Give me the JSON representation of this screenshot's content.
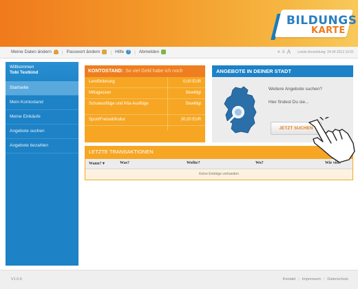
{
  "logo": {
    "line1": "BILDUNGS",
    "line2": "KARTE"
  },
  "topnav": {
    "meine_daten": "Meine Daten ändern",
    "passwort": "Passwort ändern",
    "hilfe": "Hilfe",
    "abmelden": "Abmelden",
    "font_small": "A",
    "font_medium": "A",
    "font_large": "A",
    "last_login_label": "Letzte Anmeldung: 24.04.2012 10:01"
  },
  "sidebar": {
    "welcome": "Willkommen",
    "user": "Tobi Testkind",
    "items": [
      {
        "label": "Startseite"
      },
      {
        "label": "Mein Kontostand"
      },
      {
        "label": "Meine Einkäufe"
      },
      {
        "label": "Angebote suchen"
      },
      {
        "label": "Angebote bezahlen"
      }
    ]
  },
  "kontostand": {
    "title": "KONTOSTAND:",
    "subtitle": "So viel Geld habe ich noch",
    "rows": [
      {
        "label": "Lernförderung",
        "value": "0,00 EUR"
      },
      {
        "label": "Mittagessen",
        "value": "Bewilligt"
      },
      {
        "label": "Schulausflüge und Kita-Ausflüge",
        "value": "Bewilligt"
      },
      {
        "label": "Sport/Freizeit/Kultur",
        "value": "30,00 EUR"
      }
    ]
  },
  "angebote": {
    "title": "ANGEBOTE IN DEINER STADT",
    "text1": "Weitere Angebote suchen?",
    "text2": "Hier findest Du sie...",
    "button": "JETZT SUCHEN"
  },
  "transaktionen": {
    "title": "LETZTE TRANSAKTIONEN",
    "columns": [
      "Wann? ▾",
      "Was?",
      "Wofür?",
      "Wo?",
      "Wie viel?"
    ],
    "empty": "Keine Einträge vorhanden"
  },
  "footer": {
    "version": "V1.0.6",
    "kontakt": "Kontakt",
    "impressum": "Impressum",
    "datenschutz": "Datenschutz"
  },
  "colors": {
    "orange": "#f6a623",
    "orange_dark": "#ee7e1f",
    "blue": "#1d82c6"
  }
}
